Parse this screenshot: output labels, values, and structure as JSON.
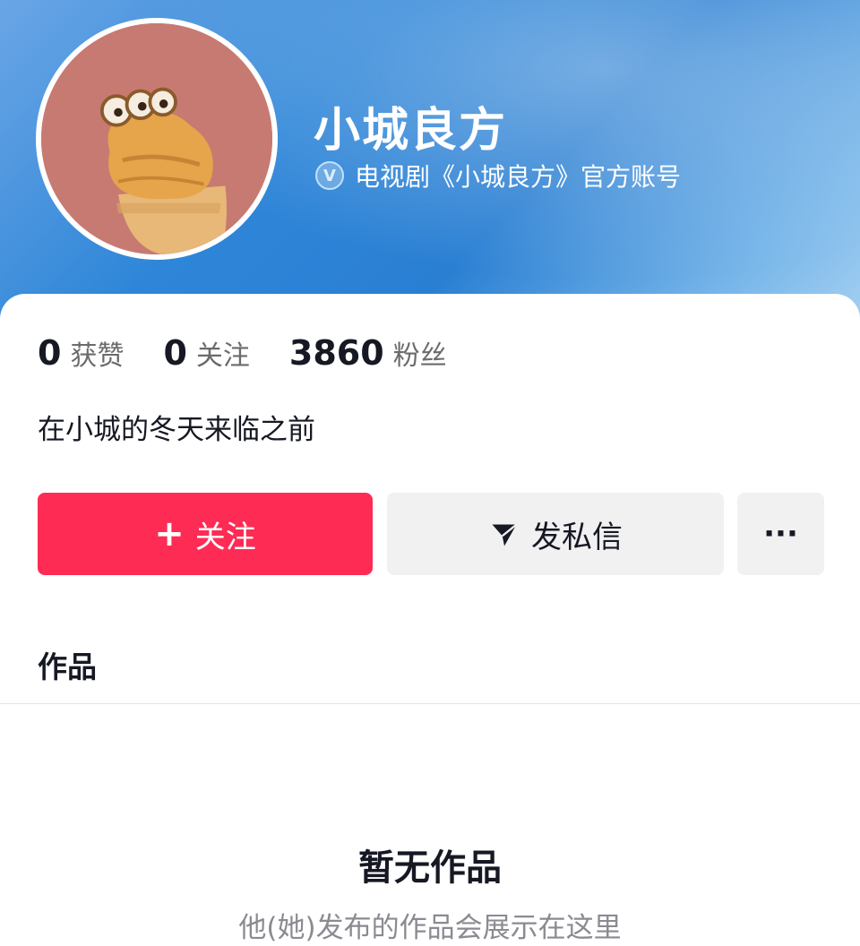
{
  "profile": {
    "name": "小城良方",
    "verify_label": "电视剧《小城良方》官方账号",
    "bio": "在小城的冬天来临之前"
  },
  "stats": [
    {
      "value": "0",
      "label": "获赞"
    },
    {
      "value": "0",
      "label": "关注"
    },
    {
      "value": "3860",
      "label": "粉丝"
    }
  ],
  "actions": {
    "follow_label": "关注",
    "message_label": "发私信",
    "more_label": "···"
  },
  "tabs": {
    "works_label": "作品"
  },
  "empty": {
    "title": "暂无作品",
    "subtitle": "他(她)发布的作品会展示在这里"
  },
  "colors": {
    "follow_button": "#fe2c55",
    "header_blue": "#2f86d8",
    "avatar_bg": "#c77a72"
  },
  "icons": {
    "follow": "plus-icon",
    "message": "send-icon",
    "verify": "verified-badge-icon",
    "more": "more-dots-icon"
  }
}
